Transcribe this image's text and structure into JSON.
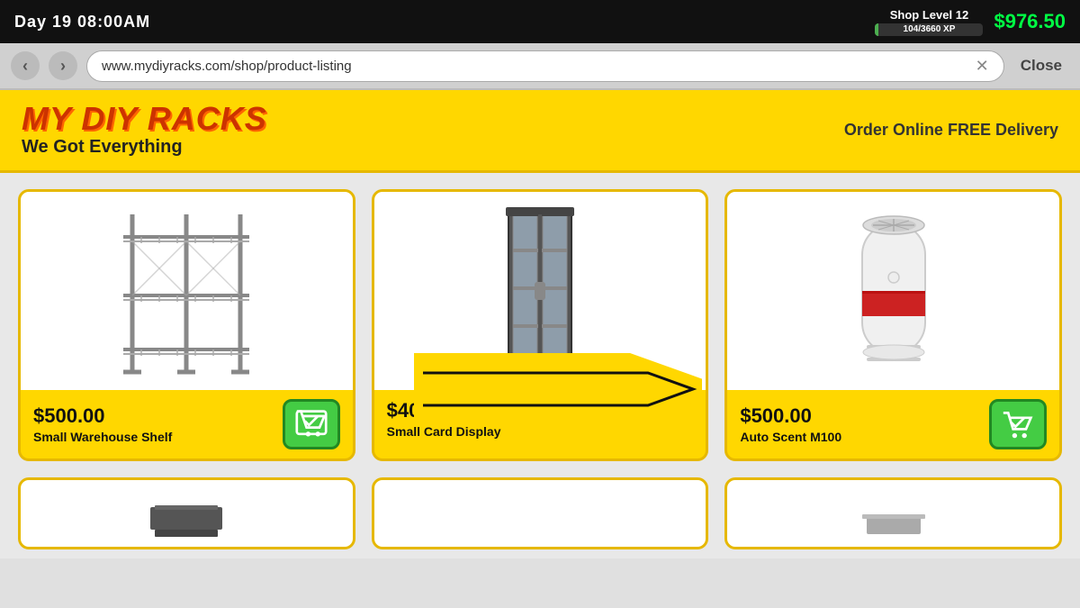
{
  "topbar": {
    "day_time": "Day 19   08:00AM",
    "shop_level": "Shop Level 12",
    "xp_current": 104,
    "xp_max": 3660,
    "xp_label": "104/3660 XP",
    "money": "$976.50"
  },
  "browser": {
    "url": "www.mydiyracks.com/shop/product-listing",
    "close_label": "Close"
  },
  "store": {
    "name": "MY DIY RACKS",
    "tagline": "We Got Everything",
    "promo": "Order Online FREE Delivery"
  },
  "products": [
    {
      "price": "$500.00",
      "name": "Small Warehouse Shelf",
      "has_cart": true
    },
    {
      "price": "$400.00",
      "name": "Small Card Display",
      "has_cart": false
    },
    {
      "price": "$500.00",
      "name": "Auto Scent M100",
      "has_cart": true
    }
  ]
}
